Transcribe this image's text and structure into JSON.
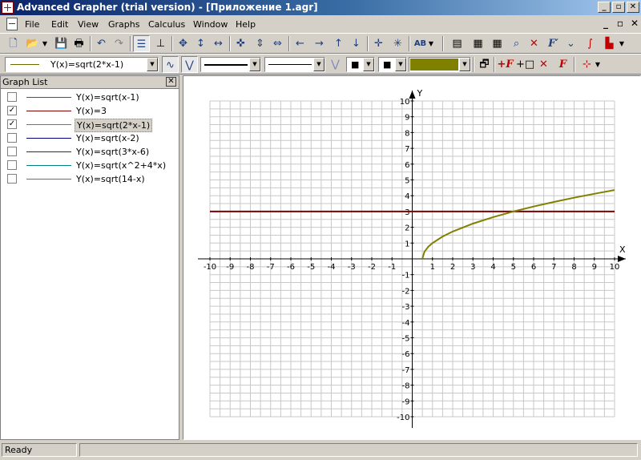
{
  "window": {
    "title": "Advanced Grapher (trial version) - [Приложение 1.agr]",
    "caption_buttons": {
      "minimize": "_",
      "restore": "▫",
      "close": "✕"
    }
  },
  "menu": {
    "items": [
      "File",
      "Edit",
      "View",
      "Graphs",
      "Calculus",
      "Window",
      "Help"
    ],
    "mdi_buttons": {
      "minimize": "_",
      "restore": "▫",
      "close": "✕"
    }
  },
  "toolbar1": {
    "icons": [
      "new-icon",
      "open-icon",
      "save-icon",
      "print-preview-icon",
      "print-icon",
      "undo-icon",
      "redo-icon",
      "graph-list-icon",
      "coordinates-icon",
      "move-icon",
      "move-vertical-icon",
      "move-horizontal-icon",
      "zoom-in-icon",
      "zoom-vertical-icon",
      "zoom-horizontal-icon",
      "arrow-left-icon",
      "arrow-right-icon",
      "arrow-up-icon",
      "arrow-down-icon",
      "center-icon",
      "fit-icon",
      "label-icon",
      "table-icon",
      "calculator-icon",
      "grid-table-icon",
      "trace-icon",
      "intersection-icon",
      "derivative-icon",
      "tangent-icon",
      "integral-icon",
      "area-icon"
    ],
    "label_button_text": "AB"
  },
  "toolbar2": {
    "graph_select_value": "Y(x)=sqrt(2*x-1)",
    "graph_select_line_color": "#6b6b00",
    "line_style_1_color": "#000000",
    "line_style_2_color": "#000000",
    "color_swatch": "#808000",
    "icons": [
      "properties-icon",
      "add-graph-icon",
      "add-object-icon",
      "delete-icon",
      "formula-icon",
      "point-icon"
    ]
  },
  "graph_list": {
    "title": "Graph List",
    "items": [
      {
        "label": "Y(x)=sqrt(x-1)",
        "checked": false,
        "color": "#008040",
        "selected": false
      },
      {
        "label": "Y(x)=3",
        "checked": true,
        "color": "#800000",
        "selected": false
      },
      {
        "label": "Y(x)=sqrt(2*x-1)",
        "checked": true,
        "color": "#808000",
        "selected": true
      },
      {
        "label": "Y(x)=sqrt(x-2)",
        "checked": false,
        "color": "#000080",
        "selected": false
      },
      {
        "label": "Y(x)=sqrt(3*x-6)",
        "checked": false,
        "color": "#800040",
        "selected": false
      },
      {
        "label": "Y(x)=sqrt(x^2+4*x)",
        "checked": false,
        "color": "#008080",
        "selected": false
      },
      {
        "label": "Y(x)=sqrt(14-x)",
        "checked": false,
        "color": "#408080",
        "selected": false
      }
    ]
  },
  "chart_data": {
    "type": "line",
    "x_axis_label": "X",
    "y_axis_label": "Y",
    "xlim": [
      -10,
      10
    ],
    "ylim": [
      -10,
      10
    ],
    "x_ticks": [
      -10,
      -9,
      -8,
      -7,
      -6,
      -5,
      -4,
      -3,
      -2,
      -1,
      1,
      2,
      3,
      4,
      5,
      6,
      7,
      8,
      9,
      10
    ],
    "y_ticks": [
      -10,
      -9,
      -8,
      -7,
      -6,
      -5,
      -4,
      -3,
      -2,
      -1,
      1,
      2,
      3,
      4,
      5,
      6,
      7,
      8,
      9,
      10
    ],
    "grid": true,
    "series": [
      {
        "name": "Y(x)=3",
        "color": "#800000",
        "x": [
          -10,
          10
        ],
        "y": [
          3,
          3
        ]
      },
      {
        "name": "Y(x)=sqrt(2*x-1)",
        "color": "#808000",
        "x": [
          0.5,
          0.6,
          0.8,
          1,
          1.5,
          2,
          3,
          4,
          5,
          6,
          7,
          8,
          9,
          10
        ],
        "y": [
          0,
          0.447,
          0.775,
          1,
          1.414,
          1.732,
          2.236,
          2.646,
          3,
          3.317,
          3.606,
          3.873,
          4.123,
          4.359
        ]
      }
    ]
  },
  "status": {
    "text": "Ready"
  }
}
